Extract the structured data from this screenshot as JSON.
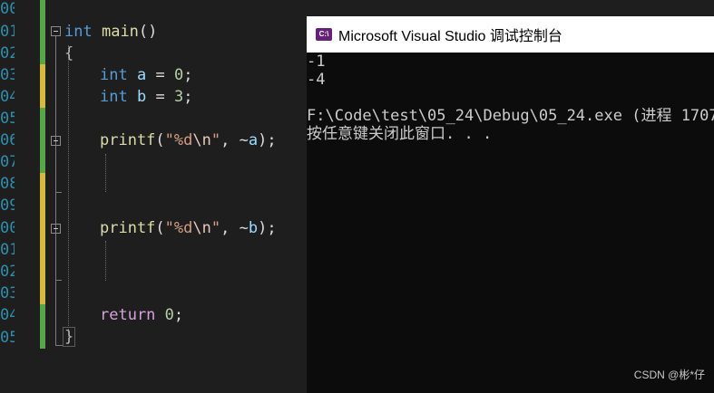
{
  "editor": {
    "line_numbers": [
      "00",
      "01",
      "02",
      "03",
      "04",
      "05",
      "06",
      "07",
      "08",
      "09",
      "00",
      "01",
      "02",
      "03",
      "04",
      "05"
    ],
    "lines": {
      "l1_type": "int",
      "l1_name": "main",
      "l1_paren": "()",
      "l2": "{",
      "l3_type": "int",
      "l3_var": "a",
      "l3_eq": " = ",
      "l3_num": "0",
      "l3_end": ";",
      "l4_type": "int",
      "l4_var": "b",
      "l4_eq": " = ",
      "l4_num": "3",
      "l4_end": ";",
      "l6_fn": "printf",
      "l6_open": "(",
      "l6_str1": "\"%d",
      "l6_esc": "\\n",
      "l6_str2": "\"",
      "l6_mid": ", ~",
      "l6_var": "a",
      "l6_end": ");",
      "l10_fn": "printf",
      "l10_open": "(",
      "l10_str1": "\"%d",
      "l10_esc": "\\n",
      "l10_str2": "\"",
      "l10_mid": ", ~",
      "l10_var": "b",
      "l10_end": ");",
      "l14_ret": "return",
      "l14_num": "0",
      "l14_end": ";",
      "l15": "}"
    }
  },
  "console": {
    "title": "Microsoft Visual Studio 调试控制台",
    "icon": "visual-studio-icon",
    "icon_label": "C:\\",
    "output": [
      "-1",
      "-4",
      "",
      "F:\\Code\\test\\05_24\\Debug\\05_24.exe (进程 1707",
      "按任意键关闭此窗口. . ."
    ]
  },
  "watermark": "CSDN @彬*仔",
  "colors": {
    "editor_bg": "#1e1e1e",
    "console_bg": "#0c0c0c",
    "keyword": "#569cd6",
    "change_green": "#57a64a",
    "change_yellow": "#d7ba3b"
  }
}
